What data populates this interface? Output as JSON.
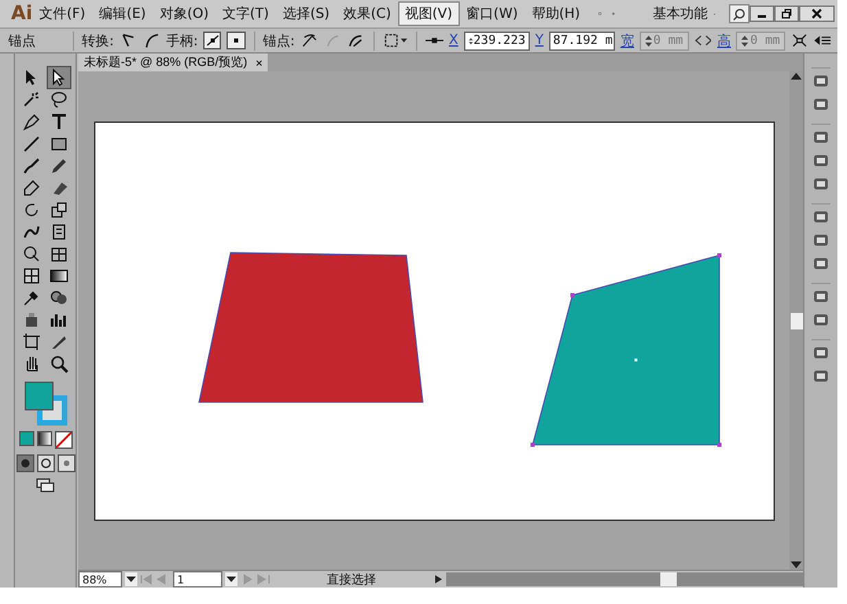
{
  "app_logo": "Ai",
  "menu": [
    {
      "label": "文件(F)",
      "selected": false
    },
    {
      "label": "编辑(E)",
      "selected": false
    },
    {
      "label": "对象(O)",
      "selected": false
    },
    {
      "label": "文字(T)",
      "selected": false
    },
    {
      "label": "选择(S)",
      "selected": false
    },
    {
      "label": "效果(C)",
      "selected": false
    },
    {
      "label": "视图(V)",
      "selected": true
    },
    {
      "label": "窗口(W)",
      "selected": false
    },
    {
      "label": "帮助(H)",
      "selected": false
    }
  ],
  "workspace": "基本功能",
  "control_bar": {
    "label": "锚点",
    "convert_label": "转换:",
    "handles_label": "手柄:",
    "anchors_label": "锚点:",
    "x_label": "X",
    "x_value": "239.223",
    "y_label": "Y",
    "y_value": "87.192 m",
    "width_label": "宽",
    "width_value": "0 mm",
    "height_label": "高",
    "height_value": "0 mm"
  },
  "document_tab": {
    "title": "未标题-5* @ 88% (RGB/预览)",
    "close": "×"
  },
  "tools": [
    {
      "selected": false
    },
    {
      "selected": true
    },
    {
      "selected": false
    },
    {
      "selected": false
    },
    {
      "selected": false
    },
    {
      "selected": false
    },
    {
      "selected": false
    },
    {
      "selected": false
    },
    {
      "selected": false
    },
    {
      "selected": false
    },
    {
      "selected": false
    },
    {
      "selected": false
    },
    {
      "selected": false
    },
    {
      "selected": false
    },
    {
      "selected": false
    },
    {
      "selected": false
    },
    {
      "selected": false
    },
    {
      "selected": false
    },
    {
      "selected": false
    },
    {
      "selected": false
    },
    {
      "selected": false
    },
    {
      "selected": false
    },
    {
      "selected": false
    },
    {
      "selected": false
    },
    {
      "selected": false
    },
    {
      "selected": false
    },
    {
      "selected": false
    },
    {
      "selected": false
    }
  ],
  "shapes": [
    {
      "color": "#c4262e",
      "selected": false
    },
    {
      "color": "#10a59c",
      "selected": true
    }
  ],
  "status_bar": {
    "zoom": "88%",
    "artboard": "1",
    "tool": "直接选择"
  }
}
